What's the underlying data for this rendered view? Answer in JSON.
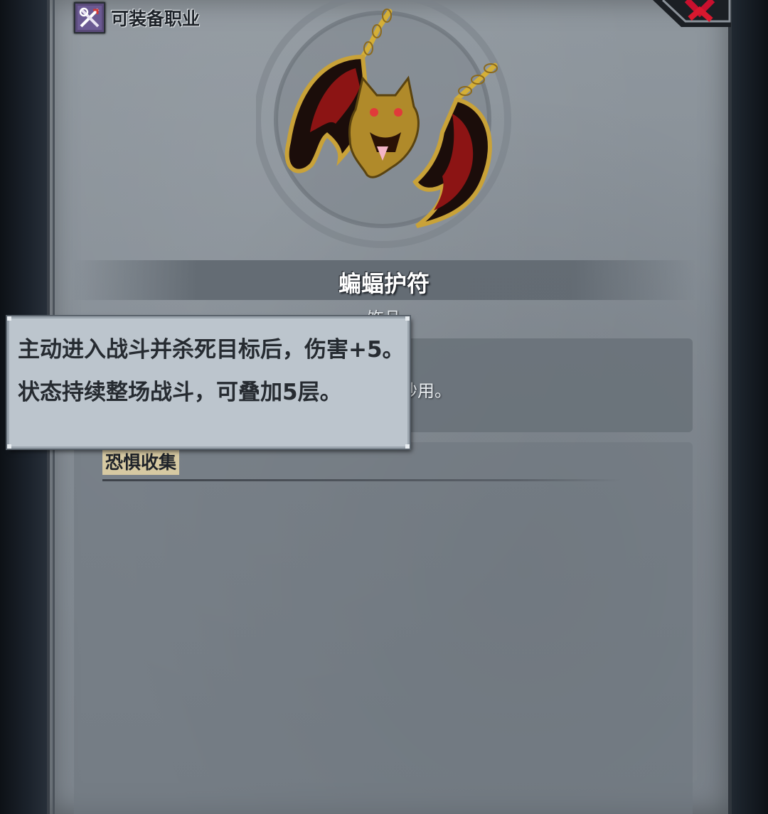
{
  "header": {
    "class_label": "可装备职业",
    "class_icon": "equip-class-icon",
    "close_icon": "close-x-icon"
  },
  "item": {
    "name": "蝙蝠护符",
    "type": "饰品",
    "description": "吓哭小孩的妙用。",
    "image": "bat-amulet-icon"
  },
  "skill": {
    "title": "恐惧收集"
  },
  "tooltip": {
    "text": "主动进入战斗并杀死目标后，伤害+5。状态持续整场战斗，可叠加5层。"
  },
  "colors": {
    "panel": "#858d95",
    "tooltip_bg": "#bcc5cd",
    "gold": "#c9a238",
    "crimson": "#8c1414"
  }
}
